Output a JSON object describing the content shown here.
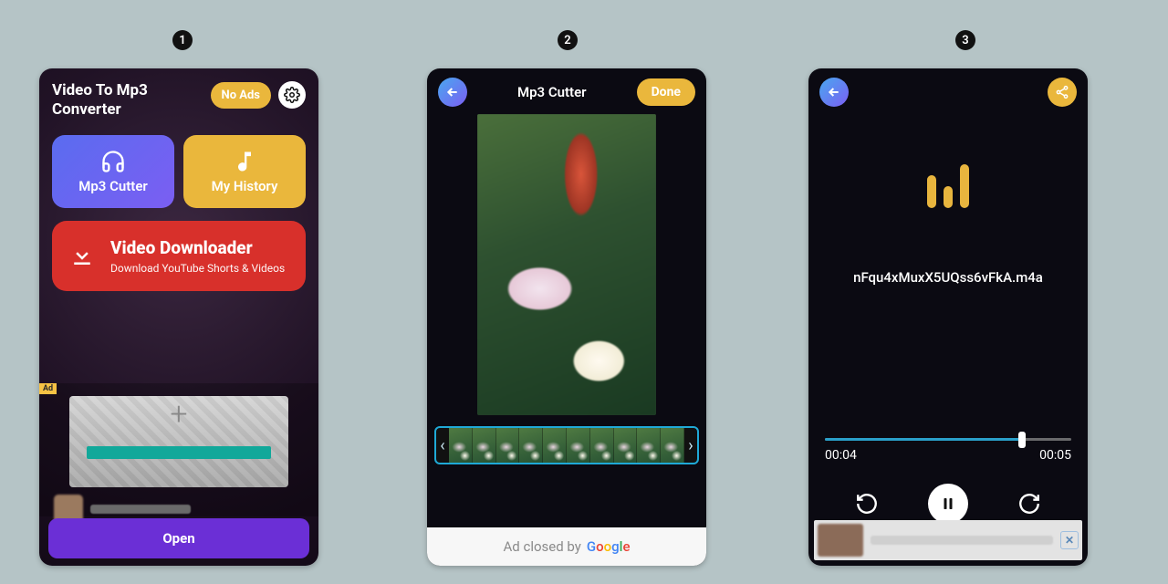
{
  "badges": {
    "one": "1",
    "two": "2",
    "three": "3"
  },
  "screen1": {
    "title": "Video To Mp3 Converter",
    "no_ads": "No Ads",
    "tile_cutter": "Mp3 Cutter",
    "tile_history": "My History",
    "downloader_title": "Video Downloader",
    "downloader_sub": "Download YouTube Shorts & Videos",
    "ad_label": "Ad",
    "open_btn": "Open"
  },
  "screen2": {
    "title": "Mp3 Cutter",
    "done": "Done",
    "ad_closed_prefix": "Ad closed by"
  },
  "screen3": {
    "filename": "nFqu4xMuxX5UQss6vFkA.m4a",
    "time_current": "00:04",
    "time_total": "00:05",
    "progress_percent": 80
  }
}
